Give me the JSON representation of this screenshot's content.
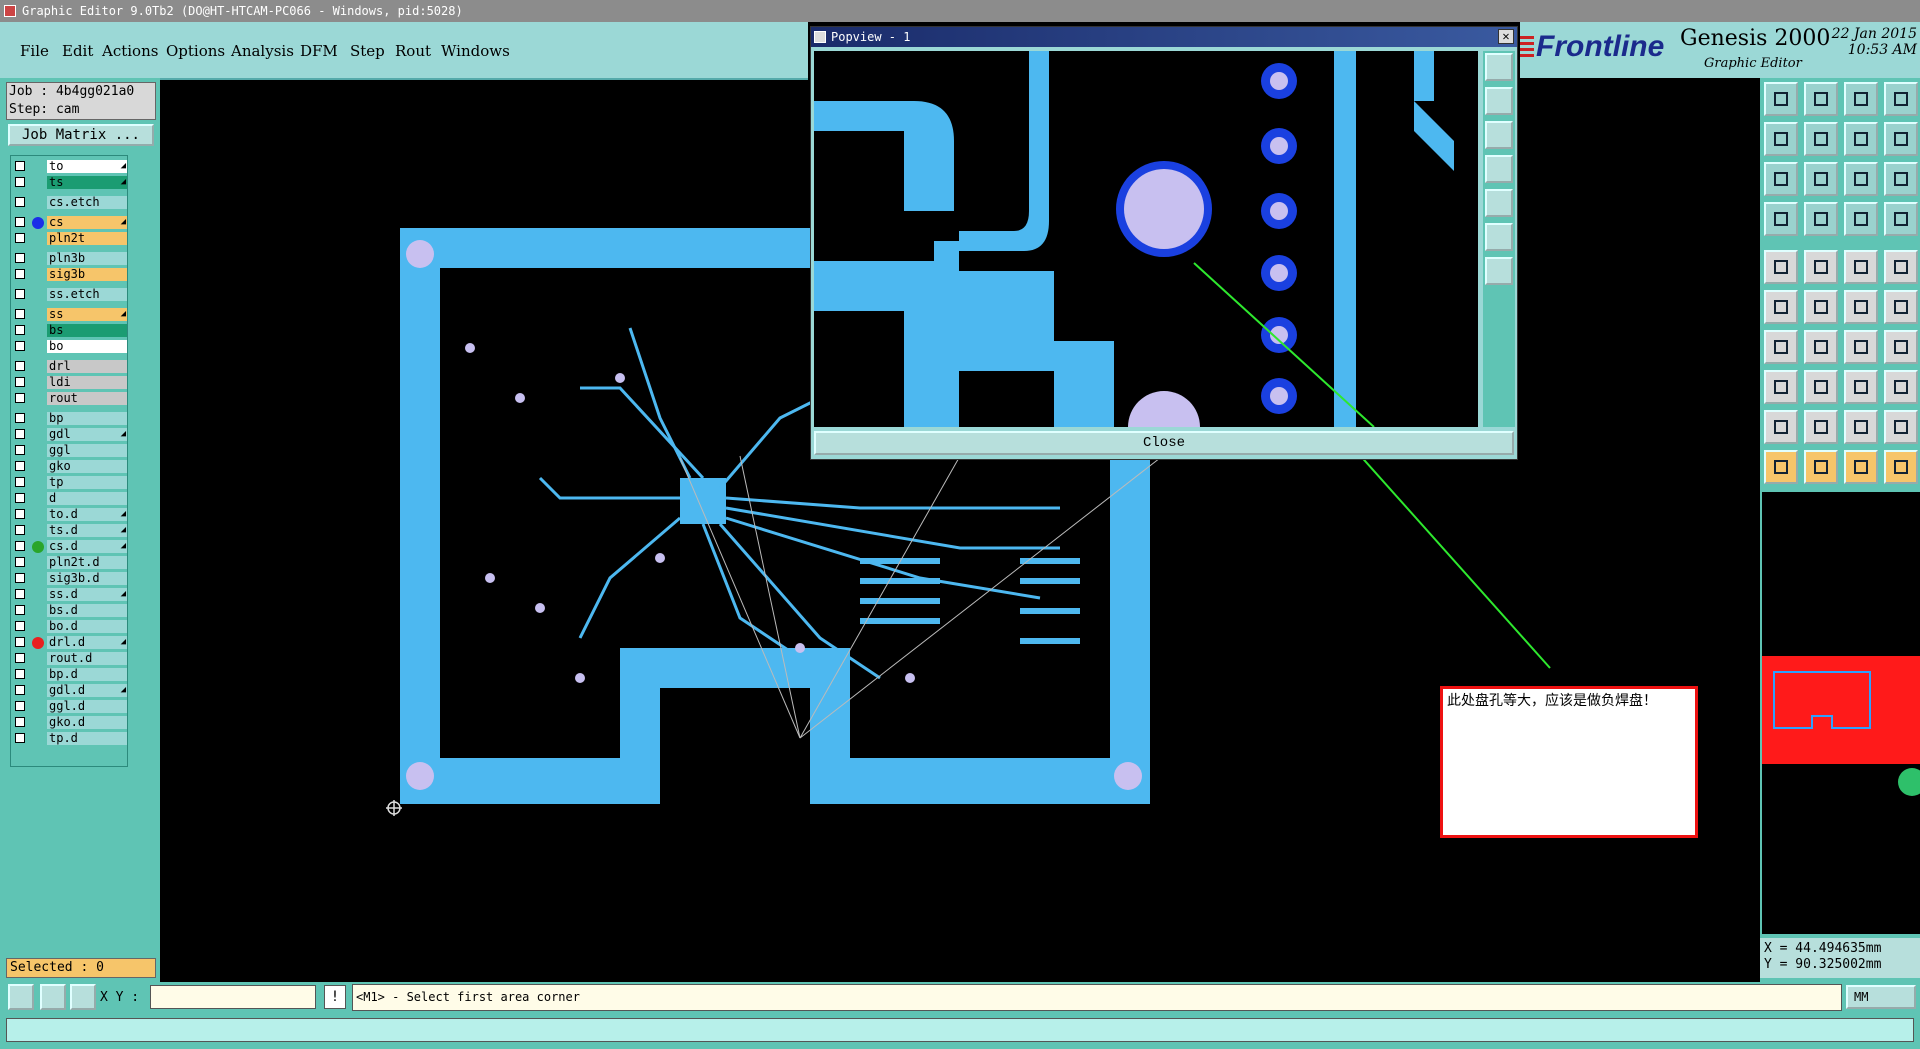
{
  "window": {
    "title": "Graphic Editor 9.0Tb2 (DO@HT-HTCAM-PC066 - Windows, pid:5028)"
  },
  "menu": [
    "File",
    "Edit",
    "Actions",
    "Options",
    "Analysis",
    "DFM",
    "Step",
    "Rout",
    "Windows"
  ],
  "logo": {
    "brand": "Frontline",
    "product": "Genesis 2000",
    "subtitle": "Graphic Editor",
    "date": "22 Jan 2015",
    "time": "10:53 AM"
  },
  "job": {
    "job_line": "Job : 4b4gg021a0",
    "step_line": "Step: cam",
    "matrix_button": "Job Matrix ..."
  },
  "layers": [
    {
      "name": "to",
      "bg": "#ffffff",
      "feat": true
    },
    {
      "name": "ts",
      "bg": "#1b9c72",
      "feat": true
    },
    {
      "name": "cs.etch",
      "bg": "#9bd8d6",
      "feat": false
    },
    {
      "name": "cs",
      "bg": "#f6c56a",
      "feat": true,
      "dot": "#1a2ee8"
    },
    {
      "name": "pln2t",
      "bg": "#f6c56a",
      "feat": false
    },
    {
      "name": "pln3b",
      "bg": "#9bd8d6",
      "feat": false
    },
    {
      "name": "sig3b",
      "bg": "#f6c56a",
      "feat": false
    },
    {
      "name": "ss.etch",
      "bg": "#9bd8d6",
      "feat": false
    },
    {
      "name": "ss",
      "bg": "#f6c56a",
      "feat": true
    },
    {
      "name": "bs",
      "bg": "#1b9c72",
      "feat": false
    },
    {
      "name": "bo",
      "bg": "#ffffff",
      "feat": false
    },
    {
      "name": "drl",
      "bg": "#c8c8c8",
      "feat": false
    },
    {
      "name": "ldi",
      "bg": "#c8c8c8",
      "feat": false
    },
    {
      "name": "rout",
      "bg": "#c8c8c8",
      "feat": false
    },
    {
      "name": "bp",
      "bg": "#9bd8d6",
      "feat": false
    },
    {
      "name": "gdl",
      "bg": "#9bd8d6",
      "feat": true
    },
    {
      "name": "ggl",
      "bg": "#9bd8d6",
      "feat": false
    },
    {
      "name": "gko",
      "bg": "#9bd8d6",
      "feat": false
    },
    {
      "name": "tp",
      "bg": "#9bd8d6",
      "feat": false
    },
    {
      "name": "d",
      "bg": "#9bd8d6",
      "feat": false
    },
    {
      "name": "to.d",
      "bg": "#9bd8d6",
      "feat": true
    },
    {
      "name": "ts.d",
      "bg": "#9bd8d6",
      "feat": true
    },
    {
      "name": "cs.d",
      "bg": "#9bd8d6",
      "feat": true,
      "dot": "#2aa52a"
    },
    {
      "name": "pln2t.d",
      "bg": "#9bd8d6",
      "feat": false
    },
    {
      "name": "sig3b.d",
      "bg": "#9bd8d6",
      "feat": false
    },
    {
      "name": "ss.d",
      "bg": "#9bd8d6",
      "feat": true
    },
    {
      "name": "bs.d",
      "bg": "#9bd8d6",
      "feat": false
    },
    {
      "name": "bo.d",
      "bg": "#9bd8d6",
      "feat": false
    },
    {
      "name": "drl.d",
      "bg": "#9bd8d6",
      "feat": true,
      "dot": "#e82020"
    },
    {
      "name": "rout.d",
      "bg": "#9bd8d6",
      "feat": false
    },
    {
      "name": "bp.d",
      "bg": "#9bd8d6",
      "feat": false
    },
    {
      "name": "gdl.d",
      "bg": "#9bd8d6",
      "feat": true
    },
    {
      "name": "ggl.d",
      "bg": "#9bd8d6",
      "feat": false
    },
    {
      "name": "gko.d",
      "bg": "#9bd8d6",
      "feat": false
    },
    {
      "name": "tp.d",
      "bg": "#9bd8d6",
      "feat": false
    }
  ],
  "selected": "Selected : 0",
  "coords": {
    "x": "X = 44.494635mm",
    "y": "Y = 90.325002mm"
  },
  "bottom": {
    "xy_label": "X Y :",
    "xy_value": "",
    "bang": "!",
    "prompt": "<M1> - Select first area corner",
    "units": "MM"
  },
  "popview": {
    "title": "Popview - 1",
    "close_x": "✕",
    "close_button": "Close"
  },
  "note": "此处盘孔等大，应该是做负焊盘！",
  "colors": {
    "copper": "#4db8f0",
    "pad": "#c8c0f0",
    "annot_arrow": "#2ee82e"
  }
}
